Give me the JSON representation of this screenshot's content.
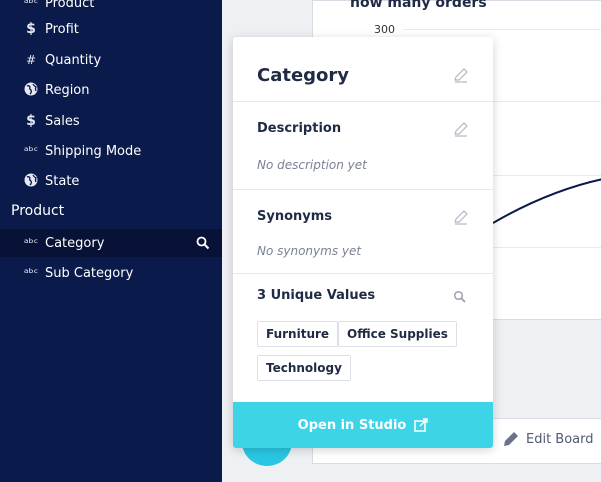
{
  "sidebar": {
    "items": [
      {
        "label": "Product",
        "icon": "abc-icon"
      },
      {
        "label": "Profit",
        "icon": "dollar-icon"
      },
      {
        "label": "Quantity",
        "icon": "hash-icon"
      },
      {
        "label": "Region",
        "icon": "globe-icon"
      },
      {
        "label": "Sales",
        "icon": "dollar-icon"
      },
      {
        "label": "Shipping Mode",
        "icon": "abc-icon"
      },
      {
        "label": "State",
        "icon": "globe-icon"
      }
    ],
    "section": "Product",
    "section_items": [
      {
        "label": "Category",
        "icon": "abc-icon",
        "active": true
      },
      {
        "label": "Sub Category",
        "icon": "abc-icon",
        "active": false
      }
    ]
  },
  "board": {
    "chart_title": "how many orders",
    "axis_tick": "300",
    "edit_board_label": "Edit Board"
  },
  "popover": {
    "title": "Category",
    "description_heading": "Description",
    "description_empty": "No description yet",
    "synonyms_heading": "Synonyms",
    "synonyms_empty": "No synonyms yet",
    "unique_heading": "3 Unique Values",
    "values": [
      "Furniture",
      "Office Supplies",
      "Technology"
    ],
    "studio_button": "Open in Studio"
  },
  "colors": {
    "sidebar_bg": "#0a1a4a",
    "accent": "#3dd4e8"
  }
}
